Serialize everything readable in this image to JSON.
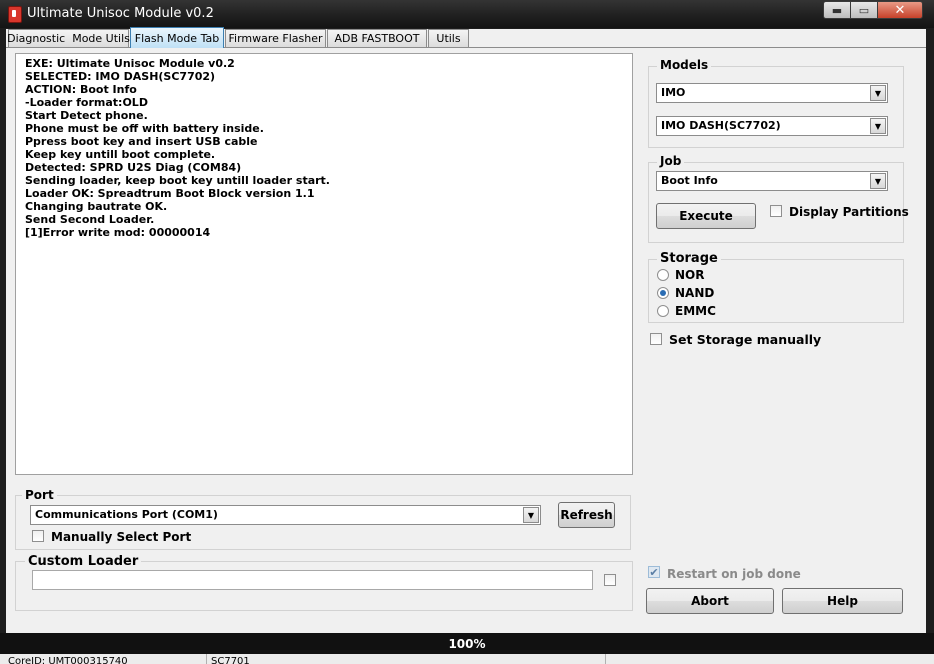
{
  "window": {
    "title": "Ultimate Unisoc Module v0.2",
    "min_symbol": "▬",
    "max_symbol": "▭",
    "close_symbol": "✕"
  },
  "tabs": [
    {
      "label": "Diagnostic  Mode Utils",
      "active": false
    },
    {
      "label": "Flash Mode Tab",
      "active": true
    },
    {
      "label": "Firmware Flasher",
      "active": false
    },
    {
      "label": "ADB FASTBOOT",
      "active": false
    },
    {
      "label": "Utils",
      "active": false
    }
  ],
  "log": [
    "EXE: Ultimate Unisoc Module v0.2",
    "SELECTED: IMO DASH(SC7702)",
    "ACTION: Boot Info",
    "-Loader format:OLD",
    "Start Detect phone.",
    "Phone must be off with battery inside.",
    "Ppress boot key and insert USB cable",
    "Keep key untill boot complete.",
    "Detected: SPRD U2S Diag (COM84)",
    "Sending loader, keep boot key untill loader start.",
    "Loader OK: Spreadtrum Boot Block version 1.1",
    "Changing bautrate OK.",
    "Send Second Loader.",
    "[1]Error write mod: 00000014"
  ],
  "models": {
    "legend": "Models",
    "brand": "IMO",
    "model": "IMO DASH(SC7702)"
  },
  "job": {
    "legend": "Job",
    "selected": "Boot Info",
    "execute_label": "Execute",
    "display_partitions_label": "Display Partitions",
    "display_partitions_checked": false
  },
  "storage": {
    "legend": "Storage",
    "options": [
      {
        "label": "NOR",
        "selected": false
      },
      {
        "label": "NAND",
        "selected": true
      },
      {
        "label": "EMMC",
        "selected": false
      }
    ],
    "set_manually_label": "Set Storage manually",
    "set_manually_checked": false
  },
  "port": {
    "legend": "Port",
    "selected": "Communications Port (COM1)",
    "refresh_label": "Refresh",
    "manual_label": "Manually Select Port",
    "manual_checked": false
  },
  "custom_loader": {
    "legend": "Custom Loader",
    "value": "",
    "checked": false
  },
  "restart": {
    "label": "Restart on job done",
    "checked": true,
    "enabled": false
  },
  "buttons": {
    "abort": "Abort",
    "help": "Help"
  },
  "progress": {
    "percent": 100,
    "text": "100%"
  },
  "statusbar": {
    "cells": [
      "CoreID: UMT000315740",
      "SC7701"
    ]
  },
  "icons": {
    "combo_arrow": "▼",
    "check_mark": "✔"
  }
}
